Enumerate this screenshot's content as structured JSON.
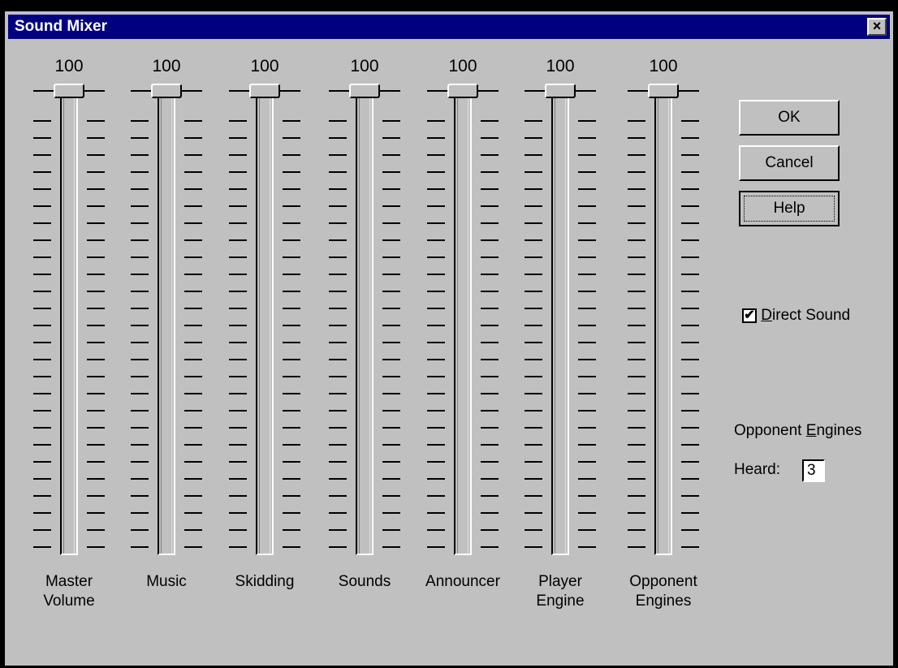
{
  "window": {
    "title": "Sound Mixer",
    "close_label": "×"
  },
  "sliders": [
    {
      "value": "100",
      "label1": "Master",
      "label2": "Volume",
      "level": 100
    },
    {
      "value": "100",
      "label1": "Music",
      "label2": "",
      "level": 100
    },
    {
      "value": "100",
      "label1": "Skidding",
      "label2": "",
      "level": 100
    },
    {
      "value": "100",
      "label1": "Sounds",
      "label2": "",
      "level": 100
    },
    {
      "value": "100",
      "label1": "Announcer",
      "label2": "",
      "level": 100
    },
    {
      "value": "100",
      "label1": "Player",
      "label2": "Engine",
      "level": 100
    },
    {
      "value": "100",
      "label1": "Opponent",
      "label2": "Engines",
      "level": 100
    }
  ],
  "buttons": {
    "ok": "OK",
    "cancel": "Cancel",
    "help": "Help"
  },
  "direct_sound": {
    "label_rest": "irect Sound",
    "mnemonic": "D",
    "checked": true,
    "check_glyph": "✔"
  },
  "opponent_engines": {
    "label_prefix": "Opponent ",
    "mnemonic": "E",
    "label_rest": "ngines",
    "heard_label": "Heard:",
    "heard_value": "3"
  }
}
